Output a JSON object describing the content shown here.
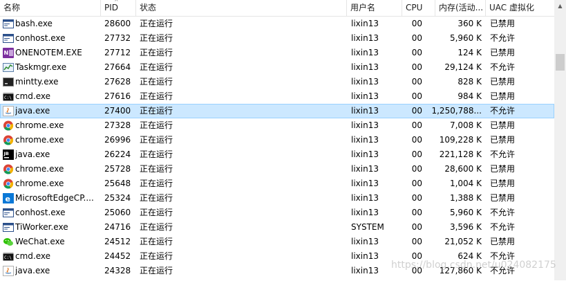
{
  "columns": {
    "name": "名称",
    "pid": "PID",
    "status": "状态",
    "user": "用户名",
    "cpu": "CPU",
    "memory": "内存(活动...",
    "uac": "UAC 虚拟化"
  },
  "sort_indicator": "^",
  "processes": [
    {
      "name": "bash.exe",
      "icon": "console-window-icon",
      "pid": "28600",
      "status": "正在运行",
      "user": "lixin13",
      "cpu": "00",
      "memory": "360 K",
      "uac": "已禁用",
      "selected": false
    },
    {
      "name": "conhost.exe",
      "icon": "console-window-icon",
      "pid": "27732",
      "status": "正在运行",
      "user": "lixin13",
      "cpu": "00",
      "memory": "5,960 K",
      "uac": "不允许",
      "selected": false
    },
    {
      "name": "ONENOTEM.EXE",
      "icon": "onenote-icon",
      "pid": "27712",
      "status": "正在运行",
      "user": "lixin13",
      "cpu": "00",
      "memory": "124 K",
      "uac": "已禁用",
      "selected": false
    },
    {
      "name": "Taskmgr.exe",
      "icon": "task-manager-icon",
      "pid": "27664",
      "status": "正在运行",
      "user": "lixin13",
      "cpu": "00",
      "memory": "29,124 K",
      "uac": "不允许",
      "selected": false
    },
    {
      "name": "mintty.exe",
      "icon": "terminal-icon",
      "pid": "27628",
      "status": "正在运行",
      "user": "lixin13",
      "cpu": "00",
      "memory": "828 K",
      "uac": "已禁用",
      "selected": false
    },
    {
      "name": "cmd.exe",
      "icon": "cmd-icon",
      "pid": "27616",
      "status": "正在运行",
      "user": "lixin13",
      "cpu": "00",
      "memory": "984 K",
      "uac": "已禁用",
      "selected": false
    },
    {
      "name": "java.exe",
      "icon": "java-icon",
      "pid": "27400",
      "status": "正在运行",
      "user": "lixin13",
      "cpu": "00",
      "memory": "1,250,788...",
      "uac": "不允许",
      "selected": true
    },
    {
      "name": "chrome.exe",
      "icon": "chrome-icon",
      "pid": "27328",
      "status": "正在运行",
      "user": "lixin13",
      "cpu": "00",
      "memory": "7,008 K",
      "uac": "已禁用",
      "selected": false
    },
    {
      "name": "chrome.exe",
      "icon": "chrome-icon",
      "pid": "26996",
      "status": "正在运行",
      "user": "lixin13",
      "cpu": "00",
      "memory": "109,228 K",
      "uac": "已禁用",
      "selected": false
    },
    {
      "name": "java.exe",
      "icon": "jetbrains-icon",
      "pid": "26224",
      "status": "正在运行",
      "user": "lixin13",
      "cpu": "00",
      "memory": "221,128 K",
      "uac": "不允许",
      "selected": false
    },
    {
      "name": "chrome.exe",
      "icon": "chrome-icon",
      "pid": "25728",
      "status": "正在运行",
      "user": "lixin13",
      "cpu": "00",
      "memory": "28,600 K",
      "uac": "已禁用",
      "selected": false
    },
    {
      "name": "chrome.exe",
      "icon": "chrome-icon",
      "pid": "25648",
      "status": "正在运行",
      "user": "lixin13",
      "cpu": "00",
      "memory": "1,004 K",
      "uac": "已禁用",
      "selected": false
    },
    {
      "name": "MicrosoftEdgeCP....",
      "icon": "edge-icon",
      "pid": "25324",
      "status": "正在运行",
      "user": "lixin13",
      "cpu": "00",
      "memory": "1,388 K",
      "uac": "已禁用",
      "selected": false
    },
    {
      "name": "conhost.exe",
      "icon": "console-window-icon",
      "pid": "25060",
      "status": "正在运行",
      "user": "lixin13",
      "cpu": "00",
      "memory": "5,960 K",
      "uac": "不允许",
      "selected": false
    },
    {
      "name": "TiWorker.exe",
      "icon": "console-window-icon",
      "pid": "24716",
      "status": "正在运行",
      "user": "SYSTEM",
      "cpu": "00",
      "memory": "3,596 K",
      "uac": "不允许",
      "selected": false
    },
    {
      "name": "WeChat.exe",
      "icon": "wechat-icon",
      "pid": "24512",
      "status": "正在运行",
      "user": "lixin13",
      "cpu": "00",
      "memory": "21,052 K",
      "uac": "已禁用",
      "selected": false
    },
    {
      "name": "cmd.exe",
      "icon": "cmd-icon",
      "pid": "24452",
      "status": "正在运行",
      "user": "lixin13",
      "cpu": "00",
      "memory": "624 K",
      "uac": "不允许",
      "selected": false
    },
    {
      "name": "java.exe",
      "icon": "java-icon",
      "pid": "24328",
      "status": "正在运行",
      "user": "lixin13",
      "cpu": "00",
      "memory": "127,860 K",
      "uac": "不允许",
      "selected": false
    }
  ],
  "watermark": "https://blog.csdn.net/u024082175",
  "colors": {
    "selection": "#cce8ff",
    "selection_border": "#99d1ff"
  }
}
